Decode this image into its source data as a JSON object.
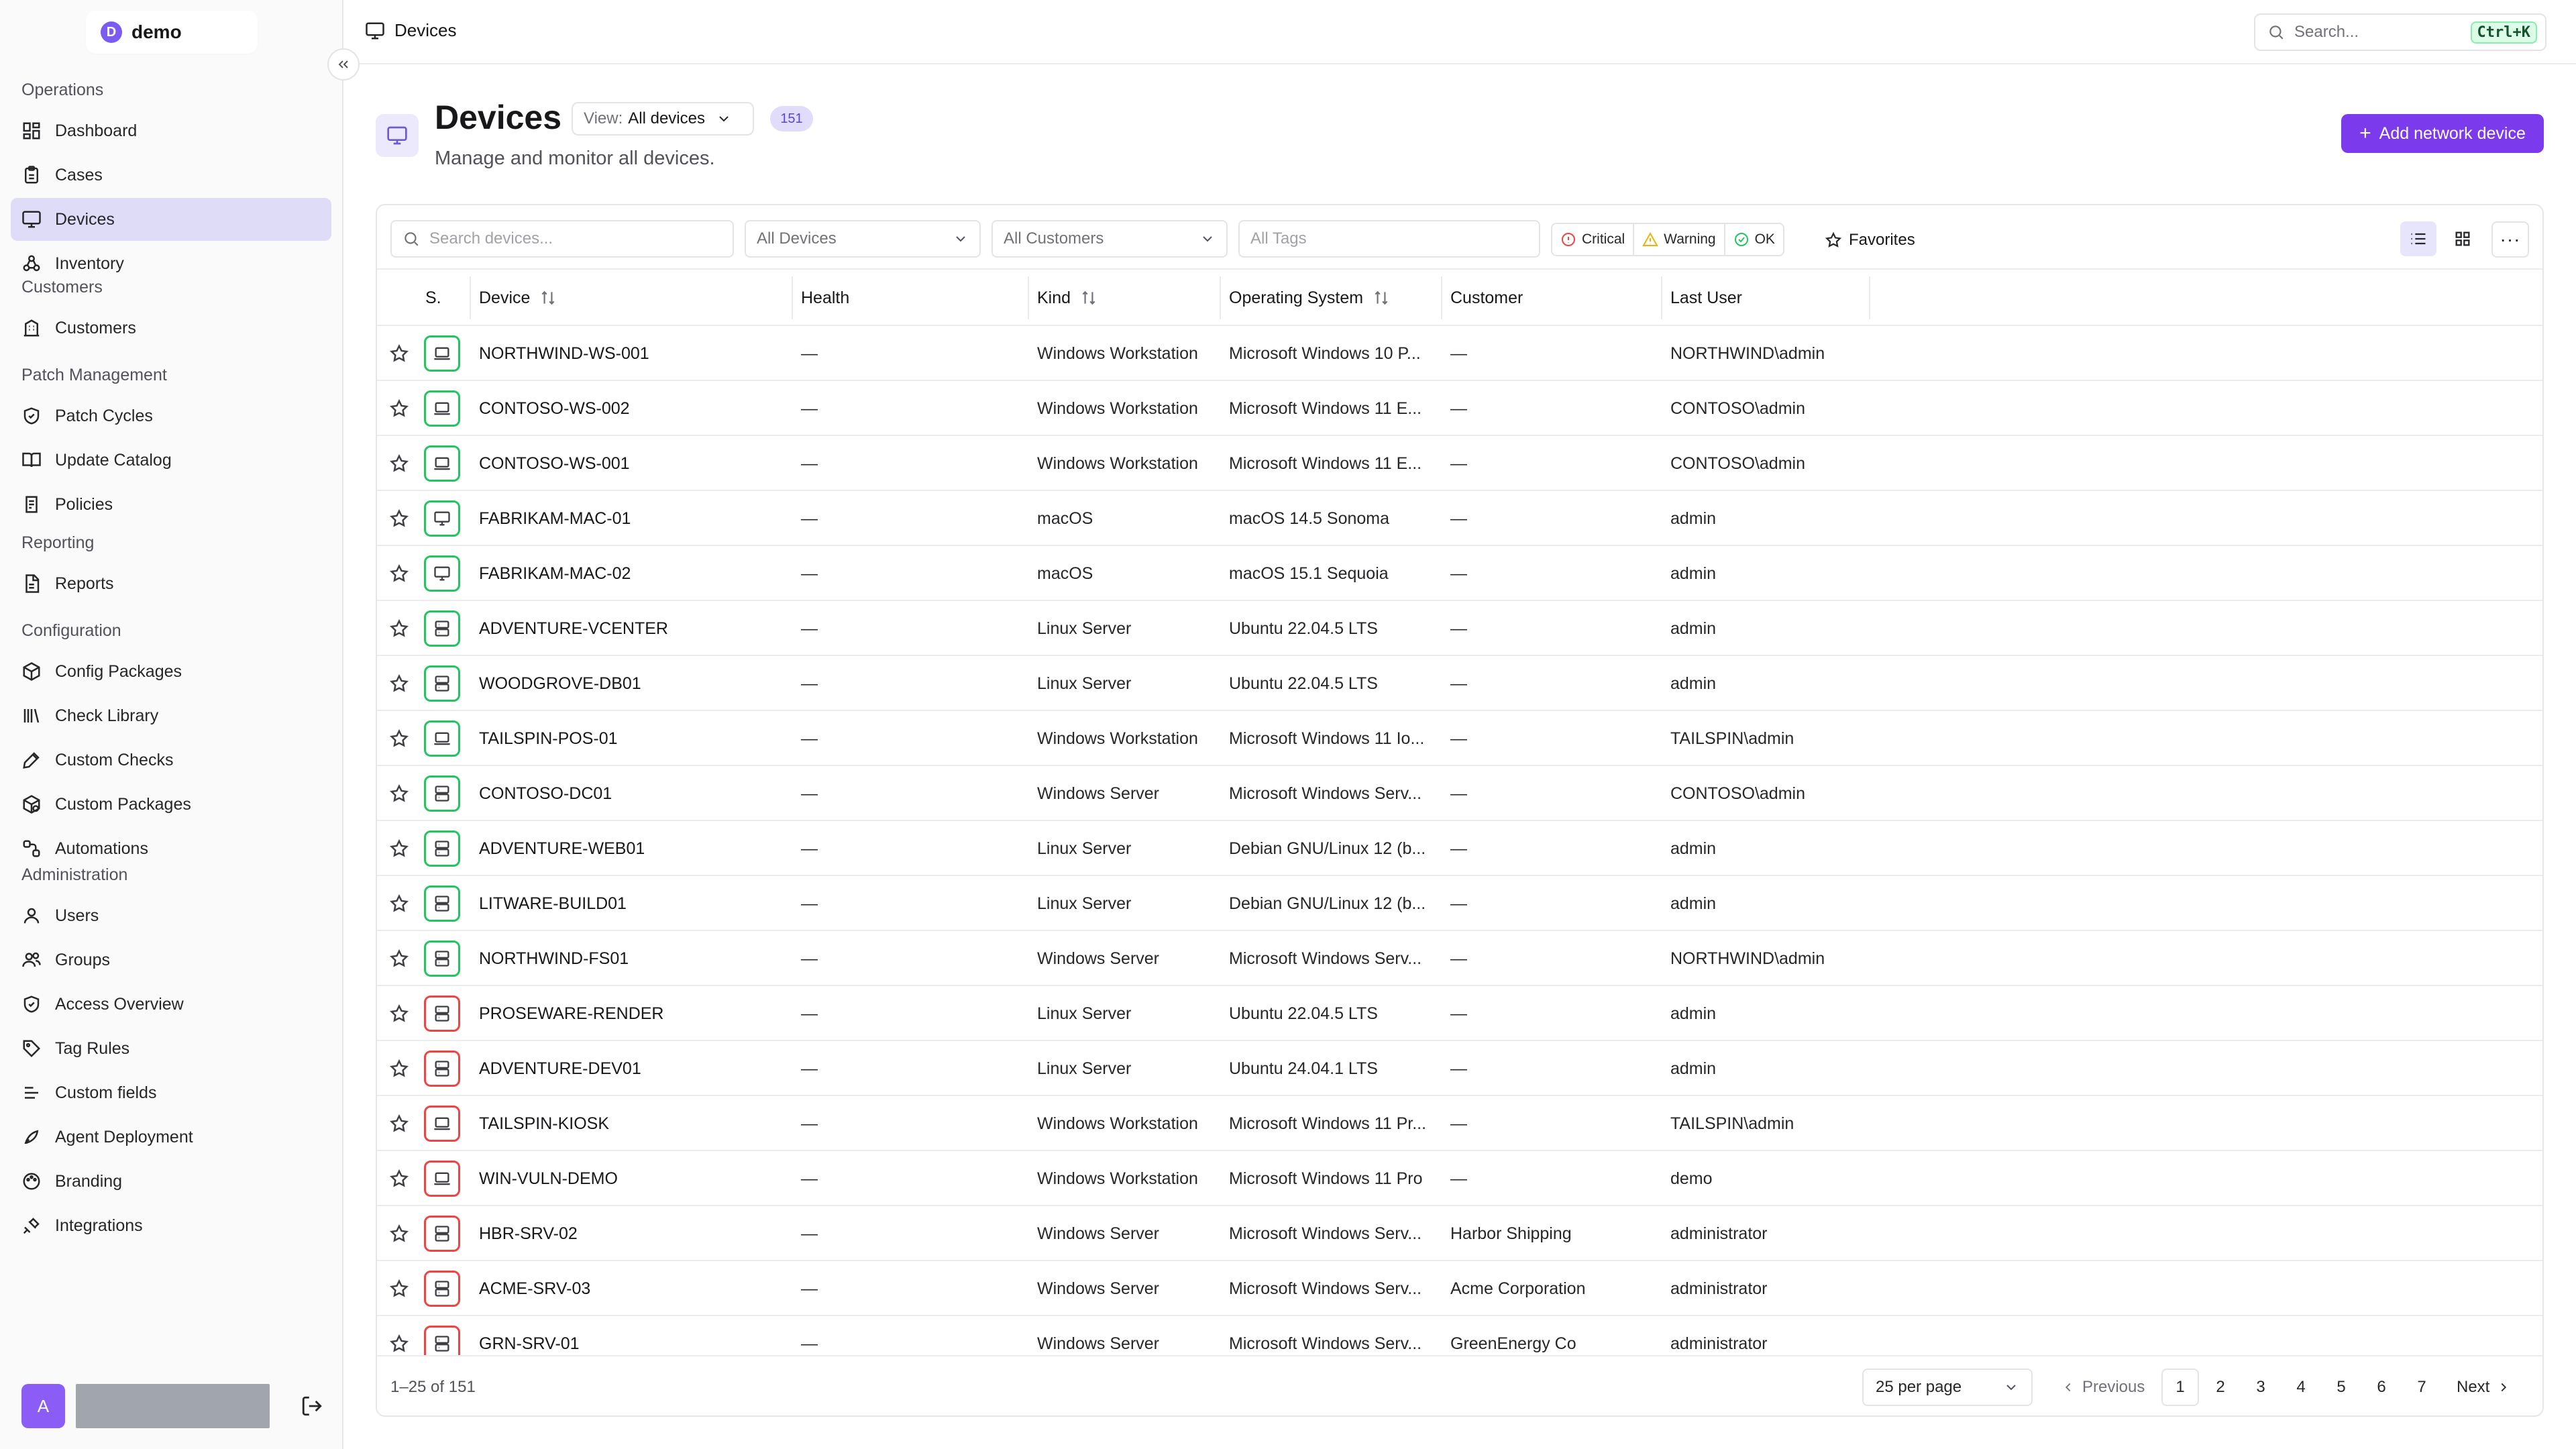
{
  "workspace": {
    "initial": "D",
    "name": "demo"
  },
  "sidebar": {
    "sections": [
      {
        "title": "Operations",
        "items": [
          "Dashboard",
          "Cases",
          "Devices",
          "Inventory"
        ]
      },
      {
        "title": "Customers",
        "items": [
          "Customers"
        ]
      },
      {
        "title": "Patch Management",
        "items": [
          "Patch Cycles",
          "Update Catalog",
          "Policies"
        ]
      },
      {
        "title": "Reporting",
        "items": [
          "Reports"
        ]
      },
      {
        "title": "Configuration",
        "items": [
          "Config Packages",
          "Check Library",
          "Custom Checks",
          "Custom Packages",
          "Automations"
        ]
      },
      {
        "title": "Administration",
        "items": [
          "Users",
          "Groups",
          "Access Overview",
          "Tag Rules",
          "Custom fields",
          "Agent Deployment",
          "Branding",
          "Integrations"
        ]
      }
    ],
    "active": "Devices",
    "user_initial": "A"
  },
  "topbar": {
    "breadcrumb": "Devices",
    "search_placeholder": "Search...",
    "shortcut": "Ctrl+K"
  },
  "page": {
    "title": "Devices",
    "view_label": "View:",
    "view_value": "All devices",
    "count": "151",
    "subtitle": "Manage and monitor all devices.",
    "add_button": "Add network device"
  },
  "toolbar": {
    "search_placeholder": "Search devices...",
    "device_filter": "All Devices",
    "customer_filter": "All Customers",
    "tags_placeholder": "All Tags",
    "status_critical": "Critical",
    "status_warning": "Warning",
    "status_ok": "OK",
    "favorites": "Favorites",
    "more": "···"
  },
  "table": {
    "columns": [
      "S.",
      "Device",
      "Health",
      "Kind",
      "Operating System",
      "Customer",
      "Last User"
    ],
    "rows": [
      {
        "device": "NORTHWIND-WS-001",
        "health": "—",
        "kind": "Windows Workstation",
        "os": "Microsoft Windows 10 P...",
        "customer": "—",
        "user": "NORTHWIND\\admin",
        "icon": "laptop",
        "status": "ok"
      },
      {
        "device": "CONTOSO-WS-002",
        "health": "—",
        "kind": "Windows Workstation",
        "os": "Microsoft Windows 11 E...",
        "customer": "—",
        "user": "CONTOSO\\admin",
        "icon": "laptop",
        "status": "ok"
      },
      {
        "device": "CONTOSO-WS-001",
        "health": "—",
        "kind": "Windows Workstation",
        "os": "Microsoft Windows 11 E...",
        "customer": "—",
        "user": "CONTOSO\\admin",
        "icon": "laptop",
        "status": "ok"
      },
      {
        "device": "FABRIKAM-MAC-01",
        "health": "—",
        "kind": "macOS",
        "os": "macOS 14.5 Sonoma",
        "customer": "—",
        "user": "admin",
        "icon": "monitor",
        "status": "ok"
      },
      {
        "device": "FABRIKAM-MAC-02",
        "health": "—",
        "kind": "macOS",
        "os": "macOS 15.1 Sequoia",
        "customer": "—",
        "user": "admin",
        "icon": "monitor",
        "status": "ok"
      },
      {
        "device": "ADVENTURE-VCENTER",
        "health": "—",
        "kind": "Linux Server",
        "os": "Ubuntu 22.04.5 LTS",
        "customer": "—",
        "user": "admin",
        "icon": "server",
        "status": "ok"
      },
      {
        "device": "WOODGROVE-DB01",
        "health": "—",
        "kind": "Linux Server",
        "os": "Ubuntu 22.04.5 LTS",
        "customer": "—",
        "user": "admin",
        "icon": "server",
        "status": "ok"
      },
      {
        "device": "TAILSPIN-POS-01",
        "health": "—",
        "kind": "Windows Workstation",
        "os": "Microsoft Windows 11 Io...",
        "customer": "—",
        "user": "TAILSPIN\\admin",
        "icon": "laptop",
        "status": "ok"
      },
      {
        "device": "CONTOSO-DC01",
        "health": "—",
        "kind": "Windows Server",
        "os": "Microsoft Windows Serv...",
        "customer": "—",
        "user": "CONTOSO\\admin",
        "icon": "server",
        "status": "ok"
      },
      {
        "device": "ADVENTURE-WEB01",
        "health": "—",
        "kind": "Linux Server",
        "os": "Debian GNU/Linux 12 (b...",
        "customer": "—",
        "user": "admin",
        "icon": "server",
        "status": "ok"
      },
      {
        "device": "LITWARE-BUILD01",
        "health": "—",
        "kind": "Linux Server",
        "os": "Debian GNU/Linux 12 (b...",
        "customer": "—",
        "user": "admin",
        "icon": "server",
        "status": "ok"
      },
      {
        "device": "NORTHWIND-FS01",
        "health": "—",
        "kind": "Windows Server",
        "os": "Microsoft Windows Serv...",
        "customer": "—",
        "user": "NORTHWIND\\admin",
        "icon": "server",
        "status": "ok"
      },
      {
        "device": "PROSEWARE-RENDER",
        "health": "—",
        "kind": "Linux Server",
        "os": "Ubuntu 22.04.5 LTS",
        "customer": "—",
        "user": "admin",
        "icon": "server",
        "status": "bad"
      },
      {
        "device": "ADVENTURE-DEV01",
        "health": "—",
        "kind": "Linux Server",
        "os": "Ubuntu 24.04.1 LTS",
        "customer": "—",
        "user": "admin",
        "icon": "server",
        "status": "bad"
      },
      {
        "device": "TAILSPIN-KIOSK",
        "health": "—",
        "kind": "Windows Workstation",
        "os": "Microsoft Windows 11 Pr...",
        "customer": "—",
        "user": "TAILSPIN\\admin",
        "icon": "laptop",
        "status": "bad"
      },
      {
        "device": "WIN-VULN-DEMO",
        "health": "—",
        "kind": "Windows Workstation",
        "os": "Microsoft Windows 11 Pro",
        "customer": "—",
        "user": "demo",
        "icon": "laptop",
        "status": "bad"
      },
      {
        "device": "HBR-SRV-02",
        "health": "—",
        "kind": "Windows Server",
        "os": "Microsoft Windows Serv...",
        "customer": "Harbor Shipping",
        "user": "administrator",
        "icon": "server",
        "status": "bad"
      },
      {
        "device": "ACME-SRV-03",
        "health": "—",
        "kind": "Windows Server",
        "os": "Microsoft Windows Serv...",
        "customer": "Acme Corporation",
        "user": "administrator",
        "icon": "server",
        "status": "bad"
      },
      {
        "device": "GRN-SRV-01",
        "health": "—",
        "kind": "Windows Server",
        "os": "Microsoft Windows Serv...",
        "customer": "GreenEnergy Co",
        "user": "administrator",
        "icon": "server",
        "status": "bad"
      }
    ]
  },
  "footer": {
    "range": "1–25 of 151",
    "per_page": "25 per page",
    "previous": "Previous",
    "next": "Next",
    "pages": [
      "1",
      "2",
      "3",
      "4",
      "5",
      "6",
      "7"
    ],
    "current_page": "1"
  },
  "colors": {
    "accent": "#7c3aed",
    "ok": "#22c55e",
    "critical": "#ef4444",
    "warning": "#eab308",
    "active_nav": "#dfdcf8"
  }
}
